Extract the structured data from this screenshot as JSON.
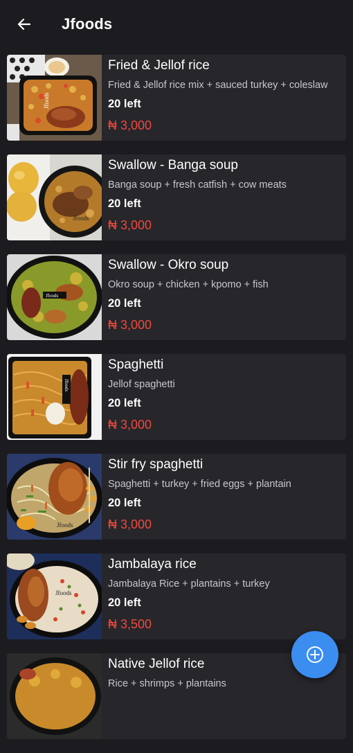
{
  "header": {
    "title": "Jfoods",
    "back_icon": "arrow-left-icon"
  },
  "items": [
    {
      "name": "Fried & Jellof rice",
      "desc": "Fried & Jellof rice mix + sauced turkey + coleslaw",
      "left": "20 left",
      "price": "₦ 3,000",
      "watermark": "Jfoods"
    },
    {
      "name": "Swallow - Banga soup",
      "desc": "Banga soup + fresh catfish + cow meats",
      "left": "20 left",
      "price": "₦ 3,000",
      "watermark": "Jfoods"
    },
    {
      "name": "Swallow - Okro soup",
      "desc": "Okro soup + chicken + kpomo + fish",
      "left": "20 left",
      "price": "₦ 3,000",
      "watermark": "Jfoods"
    },
    {
      "name": "Spaghetti",
      "desc": "Jellof spaghetti",
      "left": "20 left",
      "price": "₦ 3,000",
      "watermark": "Jfoods"
    },
    {
      "name": "Stir fry spaghetti",
      "desc": "Spaghetti + turkey + fried eggs + plantain",
      "left": "20 left",
      "price": "₦ 3,000",
      "watermark": "Jfoods"
    },
    {
      "name": "Jambalaya rice",
      "desc": "Jambalaya Rice + plantains + turkey",
      "left": "20 left",
      "price": "₦ 3,500",
      "watermark": "Jfoods"
    },
    {
      "name": "Native Jellof rice",
      "desc": "Rice + shrimps + plantains",
      "left": "",
      "price": "",
      "watermark": ""
    }
  ],
  "fab": {
    "icon": "add-circle-icon"
  },
  "colors": {
    "background": "#1c1b1f",
    "card": "#27262b",
    "price": "#ee4a3c",
    "fab": "#3b8df0"
  }
}
